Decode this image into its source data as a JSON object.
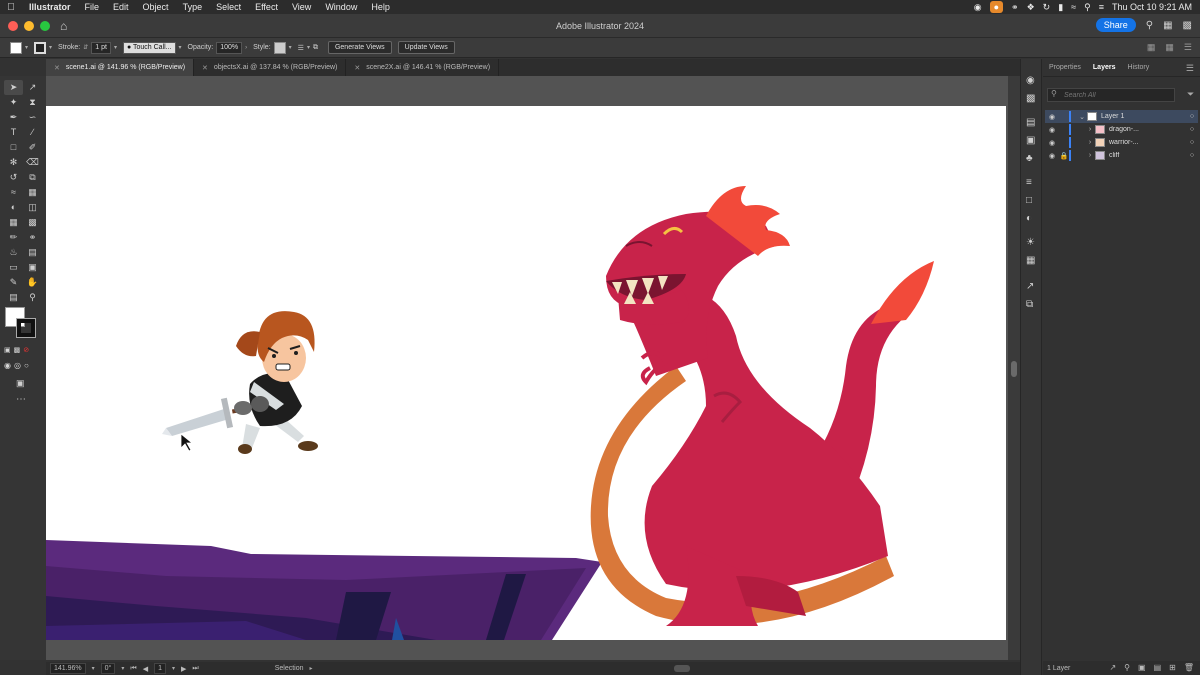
{
  "menubar": {
    "app": "Illustrator",
    "items": [
      "File",
      "Edit",
      "Object",
      "Type",
      "Select",
      "Effect",
      "View",
      "Window",
      "Help"
    ],
    "clock": "Thu Oct 10  9:21 AM"
  },
  "window": {
    "title": "Adobe Illustrator 2024",
    "share_label": "Share"
  },
  "controlbar": {
    "stroke_label": "Stroke:",
    "stroke_value": "1 pt",
    "brush_value": "Touch Call...",
    "opacity_label": "Opacity:",
    "opacity_value": "100%",
    "style_label": "Style:",
    "generate_views": "Generate Views",
    "update_views": "Update Views"
  },
  "tabs": [
    {
      "label": "scene1.ai @ 141.96 % (RGB/Preview)",
      "active": true
    },
    {
      "label": "objectsX.ai @ 137.84 % (RGB/Preview)",
      "active": false
    },
    {
      "label": "scene2X.ai @ 146.41 % (RGB/Preview)",
      "active": false
    }
  ],
  "statusbar": {
    "zoom": "141.96%",
    "rotation": "0°",
    "artboard": "1",
    "tool": "Selection"
  },
  "panel": {
    "tabs": [
      "Properties",
      "Layers",
      "History"
    ],
    "active_tab": "Layers",
    "search_placeholder": "Search All",
    "layers": [
      {
        "name": "Layer 1",
        "level": 0,
        "locked": false,
        "selected": true
      },
      {
        "name": "dragon-...",
        "level": 1,
        "locked": false,
        "selected": false
      },
      {
        "name": "warrior-...",
        "level": 1,
        "locked": false,
        "selected": false
      },
      {
        "name": "cliff",
        "level": 1,
        "locked": true,
        "selected": false
      }
    ],
    "footer": "1 Layer"
  },
  "colors": {
    "dragon_body": "#c8234a",
    "dragon_belly": "#d9783a",
    "dragon_crest": "#f24a3a",
    "cliff_purple": "#5a2a7a",
    "accent_blue": "#1473e6"
  }
}
